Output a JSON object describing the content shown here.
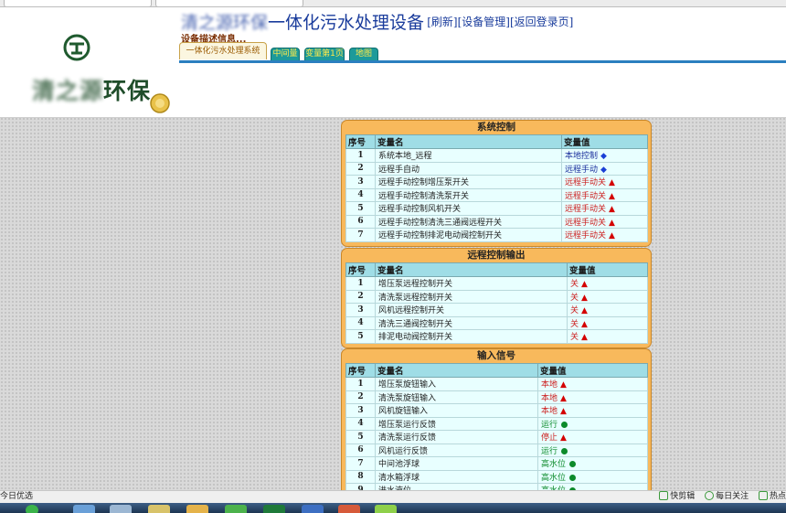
{
  "header": {
    "title_obscured": "清之源环保",
    "title_main": "一体化污水处理设备",
    "links": [
      "[刷新]",
      "[设备管理]",
      "[返回登录页]"
    ],
    "desc_label": "设备描述信息...",
    "logo_text_obscured": "清之源",
    "logo_text_main": "环保"
  },
  "tabs": [
    {
      "label": "一体化污水处理系统",
      "active": true
    },
    {
      "label": "中间量",
      "active": false
    },
    {
      "label": "变量第1页",
      "active": false
    },
    {
      "label": "地图",
      "active": false
    }
  ],
  "columns": {
    "idx": "序号",
    "name": "变量名",
    "value": "变量值"
  },
  "panels": [
    {
      "title": "系统控制",
      "rows": [
        {
          "idx": "1",
          "name": "系统本地_远程",
          "value": "本地控制",
          "tone": "blue",
          "marker": "diamond"
        },
        {
          "idx": "2",
          "name": "远程手自动",
          "value": "远程手动",
          "tone": "blue",
          "marker": "diamond"
        },
        {
          "idx": "3",
          "name": "远程手动控制增压泵开关",
          "value": "远程手动关",
          "tone": "red",
          "marker": "triangle"
        },
        {
          "idx": "4",
          "name": "远程手动控制清洗泵开关",
          "value": "远程手动关",
          "tone": "red",
          "marker": "triangle"
        },
        {
          "idx": "5",
          "name": "远程手动控制风机开关",
          "value": "远程手动关",
          "tone": "red",
          "marker": "triangle"
        },
        {
          "idx": "6",
          "name": "远程手动控制清洗三通阀远程开关",
          "value": "远程手动关",
          "tone": "red",
          "marker": "triangle"
        },
        {
          "idx": "7",
          "name": "远程手动控制排泥电动阀控制开关",
          "value": "远程手动关",
          "tone": "red",
          "marker": "triangle"
        }
      ]
    },
    {
      "title": "远程控制输出",
      "rows": [
        {
          "idx": "1",
          "name": "增压泵远程控制开关",
          "value": "关",
          "tone": "red",
          "marker": "triangle"
        },
        {
          "idx": "2",
          "name": "清洗泵远程控制开关",
          "value": "关",
          "tone": "red",
          "marker": "triangle"
        },
        {
          "idx": "3",
          "name": "风机远程控制开关",
          "value": "关",
          "tone": "red",
          "marker": "triangle"
        },
        {
          "idx": "4",
          "name": "清洗三通阀控制开关",
          "value": "关",
          "tone": "red",
          "marker": "triangle"
        },
        {
          "idx": "5",
          "name": "排泥电动阀控制开关",
          "value": "关",
          "tone": "red",
          "marker": "triangle"
        }
      ]
    },
    {
      "title": "输入信号",
      "rows": [
        {
          "idx": "1",
          "name": "增压泵旋钮输入",
          "value": "本地",
          "tone": "red",
          "marker": "triangle"
        },
        {
          "idx": "2",
          "name": "清洗泵旋钮输入",
          "value": "本地",
          "tone": "red",
          "marker": "triangle"
        },
        {
          "idx": "3",
          "name": "风机旋钮输入",
          "value": "本地",
          "tone": "red",
          "marker": "triangle"
        },
        {
          "idx": "4",
          "name": "增压泵运行反馈",
          "value": "运行",
          "tone": "green",
          "marker": "dot"
        },
        {
          "idx": "5",
          "name": "清洗泵运行反馈",
          "value": "停止",
          "tone": "red",
          "marker": "triangle"
        },
        {
          "idx": "6",
          "name": "风机运行反馈",
          "value": "运行",
          "tone": "green",
          "marker": "dot"
        },
        {
          "idx": "7",
          "name": "中间池浮球",
          "value": "高水位",
          "tone": "green",
          "marker": "dot"
        },
        {
          "idx": "8",
          "name": "清水箱浮球",
          "value": "高水位",
          "tone": "green",
          "marker": "dot"
        },
        {
          "idx": "9",
          "name": "进水液位",
          "value": "高水位",
          "tone": "green",
          "marker": "dot"
        }
      ]
    }
  ],
  "statusbar": {
    "left": "今日优选",
    "right": [
      "快剪辑",
      "每日关注",
      "热点"
    ]
  },
  "colors": {
    "panel_bg": "#f8b95c",
    "header_cell": "#9fdde6",
    "table_bg": "#e8ffff",
    "title_blue": "#1a3c9c",
    "value_red": "#cc1d1d",
    "value_blue": "#1b2f9c",
    "value_green": "#0c8a2a"
  }
}
